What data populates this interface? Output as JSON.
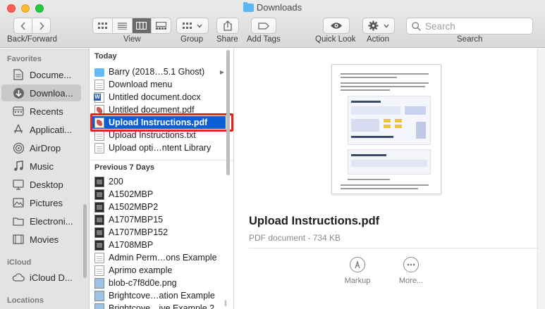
{
  "window": {
    "title": "Downloads"
  },
  "toolbar": {
    "back_forward_label": "Back/Forward",
    "view_label": "View",
    "group_label": "Group",
    "share_label": "Share",
    "add_tags_label": "Add Tags",
    "quick_look_label": "Quick Look",
    "action_label": "Action",
    "search_label": "Search",
    "search_placeholder": "Search"
  },
  "sidebar": {
    "favorites_header": "Favorites",
    "favorites": [
      {
        "label": "Docume...",
        "icon": "document-icon"
      },
      {
        "label": "Downloa...",
        "icon": "download-icon",
        "active": true
      },
      {
        "label": "Recents",
        "icon": "clock-icon"
      },
      {
        "label": "Applicati...",
        "icon": "applications-icon"
      },
      {
        "label": "AirDrop",
        "icon": "airdrop-icon"
      },
      {
        "label": "Music",
        "icon": "music-icon"
      },
      {
        "label": "Desktop",
        "icon": "desktop-icon"
      },
      {
        "label": "Pictures",
        "icon": "pictures-icon"
      },
      {
        "label": "Electroni...",
        "icon": "folder-icon"
      },
      {
        "label": "Movies",
        "icon": "movies-icon"
      }
    ],
    "icloud_header": "iCloud",
    "icloud": [
      {
        "label": "iCloud D...",
        "icon": "cloud-icon"
      }
    ],
    "locations_header": "Locations"
  },
  "list": {
    "today_header": "Today",
    "today": [
      {
        "name": "Barry (2018…5.1 Ghost)",
        "kind": "folder",
        "has_arrow": true
      },
      {
        "name": "Download menu",
        "kind": "doc"
      },
      {
        "name": "Untitled document.docx",
        "kind": "word"
      },
      {
        "name": "Untitled document.pdf",
        "kind": "pdf"
      },
      {
        "name": "Upload Instructions.pdf",
        "kind": "pdf",
        "selected": true
      },
      {
        "name": "Upload Instructions.txt",
        "kind": "doc"
      },
      {
        "name": "Upload opti…ntent Library",
        "kind": "doc"
      }
    ],
    "previous_header": "Previous 7 Days",
    "previous": [
      {
        "name": "200",
        "kind": "img"
      },
      {
        "name": "A1502MBP",
        "kind": "img"
      },
      {
        "name": "A1502MBP2",
        "kind": "img"
      },
      {
        "name": "A1707MBP15",
        "kind": "img"
      },
      {
        "name": "A1707MBP152",
        "kind": "img"
      },
      {
        "name": "A1708MBP",
        "kind": "img"
      },
      {
        "name": "Admin Perm…ons Example",
        "kind": "doc"
      },
      {
        "name": "Aprimo example",
        "kind": "doc"
      },
      {
        "name": "blob-c7f8d0e.png",
        "kind": "png"
      },
      {
        "name": "Brightcove…ation Example",
        "kind": "png"
      },
      {
        "name": "Brightcove…ive Example 2",
        "kind": "png"
      }
    ]
  },
  "preview": {
    "filename": "Upload Instructions.pdf",
    "subtitle": "PDF document - 734 KB",
    "markup_label": "Markup",
    "more_label": "More..."
  },
  "colors": {
    "selection": "#0a5fd6",
    "highlight_box": "#e1261c"
  }
}
